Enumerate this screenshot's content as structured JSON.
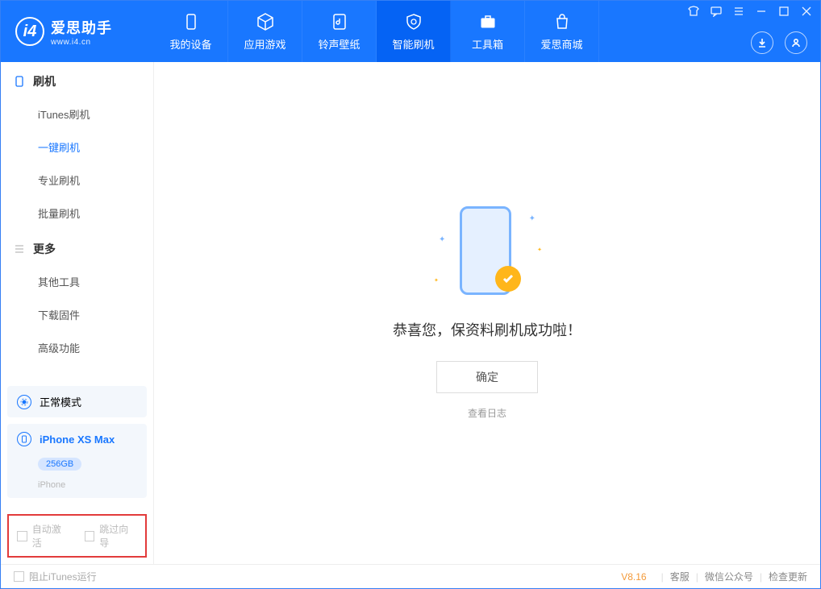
{
  "app": {
    "name_cn": "爱思助手",
    "name_en": "www.i4.cn"
  },
  "tabs": [
    {
      "label": "我的设备"
    },
    {
      "label": "应用游戏"
    },
    {
      "label": "铃声壁纸"
    },
    {
      "label": "智能刷机"
    },
    {
      "label": "工具箱"
    },
    {
      "label": "爱思商城"
    }
  ],
  "sidebar": {
    "section1": {
      "title": "刷机",
      "items": [
        "iTunes刷机",
        "一键刷机",
        "专业刷机",
        "批量刷机"
      ]
    },
    "section2": {
      "title": "更多",
      "items": [
        "其他工具",
        "下载固件",
        "高级功能"
      ]
    }
  },
  "mode_card": {
    "label": "正常模式"
  },
  "device_card": {
    "name": "iPhone XS Max",
    "storage": "256GB",
    "type": "iPhone"
  },
  "checkboxes": {
    "auto_activate": "自动激活",
    "skip_guide": "跳过向导"
  },
  "main": {
    "success_text": "恭喜您，保资料刷机成功啦！",
    "ok_button": "确定",
    "view_log": "查看日志"
  },
  "footer": {
    "block_itunes": "阻止iTunes运行",
    "version": "V8.16",
    "links": [
      "客服",
      "微信公众号",
      "检查更新"
    ]
  }
}
